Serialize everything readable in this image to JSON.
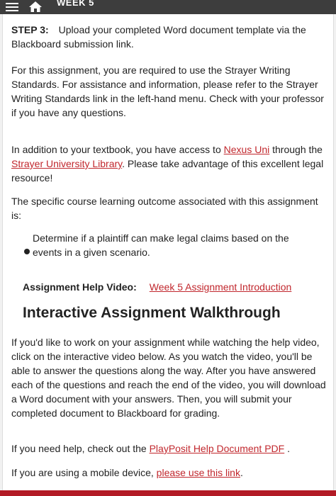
{
  "topbar": {
    "title": "WEEK 5",
    "menu_icon": "hamburger-menu-icon",
    "home_icon": "home-icon"
  },
  "step3": {
    "label": "STEP 3:",
    "text": "Upload your completed Word document template via the Blackboard submission link."
  },
  "standards_text": "For this assignment, you are required to use the Strayer Writing Standards. For assistance and information, please refer to the Strayer Writing Standards link in the left-hand menu. Check with your professor if you have any questions.",
  "resources": {
    "prefix": "In addition to your textbook, you have access to ",
    "nexus_link": "Nexus Uni",
    "middle": " through the ",
    "library_link": "Strayer University Library",
    "suffix": ". Please take advantage of this excellent legal resource!"
  },
  "outcome_intro": "The specific course learning outcome associated with this assignment is:",
  "outcomes": [
    "Determine if a plaintiff can make legal claims based on the events in a given scenario."
  ],
  "help_video": {
    "label": "Assignment Help Video:",
    "link": "Week 5 Assignment Introduction"
  },
  "walkthrough_heading": "Interactive Assignment Walkthrough",
  "walkthrough_text": "If you'd like to work on your assignment while watching the help video, click on the interactive video below. As you watch the video, you'll be able to answer the questions along the way. After you have answered each of the questions and reach the end of the video, you will download a Word document with your answers. Then, you will submit your completed document to Blackboard for grading.",
  "playposit": {
    "prefix": "If you need help, check out the ",
    "link": "PlayPosit Help Document PDF",
    "suffix": " ."
  },
  "mobile": {
    "prefix": "If you are using a mobile device, ",
    "link": "please use this link",
    "suffix": "."
  },
  "colors": {
    "link": "#c1272d",
    "topbar": "#3d3d3d",
    "bottombar": "#b21a25"
  }
}
